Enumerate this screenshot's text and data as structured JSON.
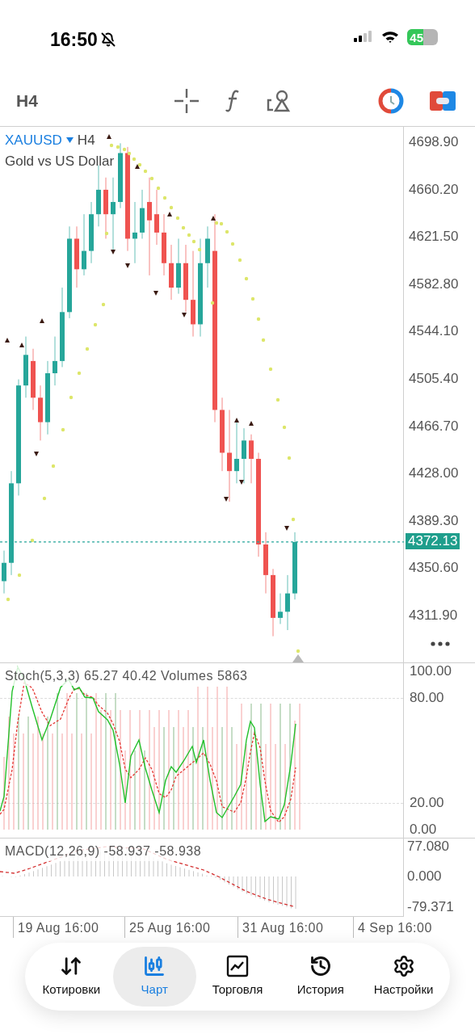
{
  "status_bar": {
    "time": "16:50",
    "battery": "45"
  },
  "toolbar": {
    "timeframe": "H4"
  },
  "chart": {
    "symbol": "XAUUSD",
    "timeframe": "H4",
    "description": "Gold vs US Dollar",
    "current_price": "4372.13",
    "price_axis": [
      "4698.90",
      "4660.20",
      "4621.50",
      "4582.80",
      "4544.10",
      "4505.40",
      "4466.70",
      "4428.00",
      "4389.30",
      "4350.60",
      "4311.90"
    ]
  },
  "stochastic": {
    "legend": "Stoch(5,3,3) 65.27 40.42 Volumes 5863",
    "axis": [
      "100.00",
      "80.00",
      "20.00",
      "0.00"
    ]
  },
  "macd": {
    "legend": "MACD(12,26,9) -58.937 -58.938",
    "axis": [
      "77.080",
      "0.000",
      "-79.371"
    ]
  },
  "time_axis": [
    "19 Aug 16:00",
    "25 Aug 16:00",
    "31 Aug 16:00",
    "4 Sep 16:00"
  ],
  "nav": [
    {
      "kind": "quotes",
      "label": "Котировки",
      "selected": false
    },
    {
      "kind": "chart",
      "label": "Чарт",
      "selected": true
    },
    {
      "kind": "trade",
      "label": "Торговля",
      "selected": false
    },
    {
      "kind": "history",
      "label": "История",
      "selected": false
    },
    {
      "kind": "settings",
      "label": "Настройки",
      "selected": false
    }
  ]
}
